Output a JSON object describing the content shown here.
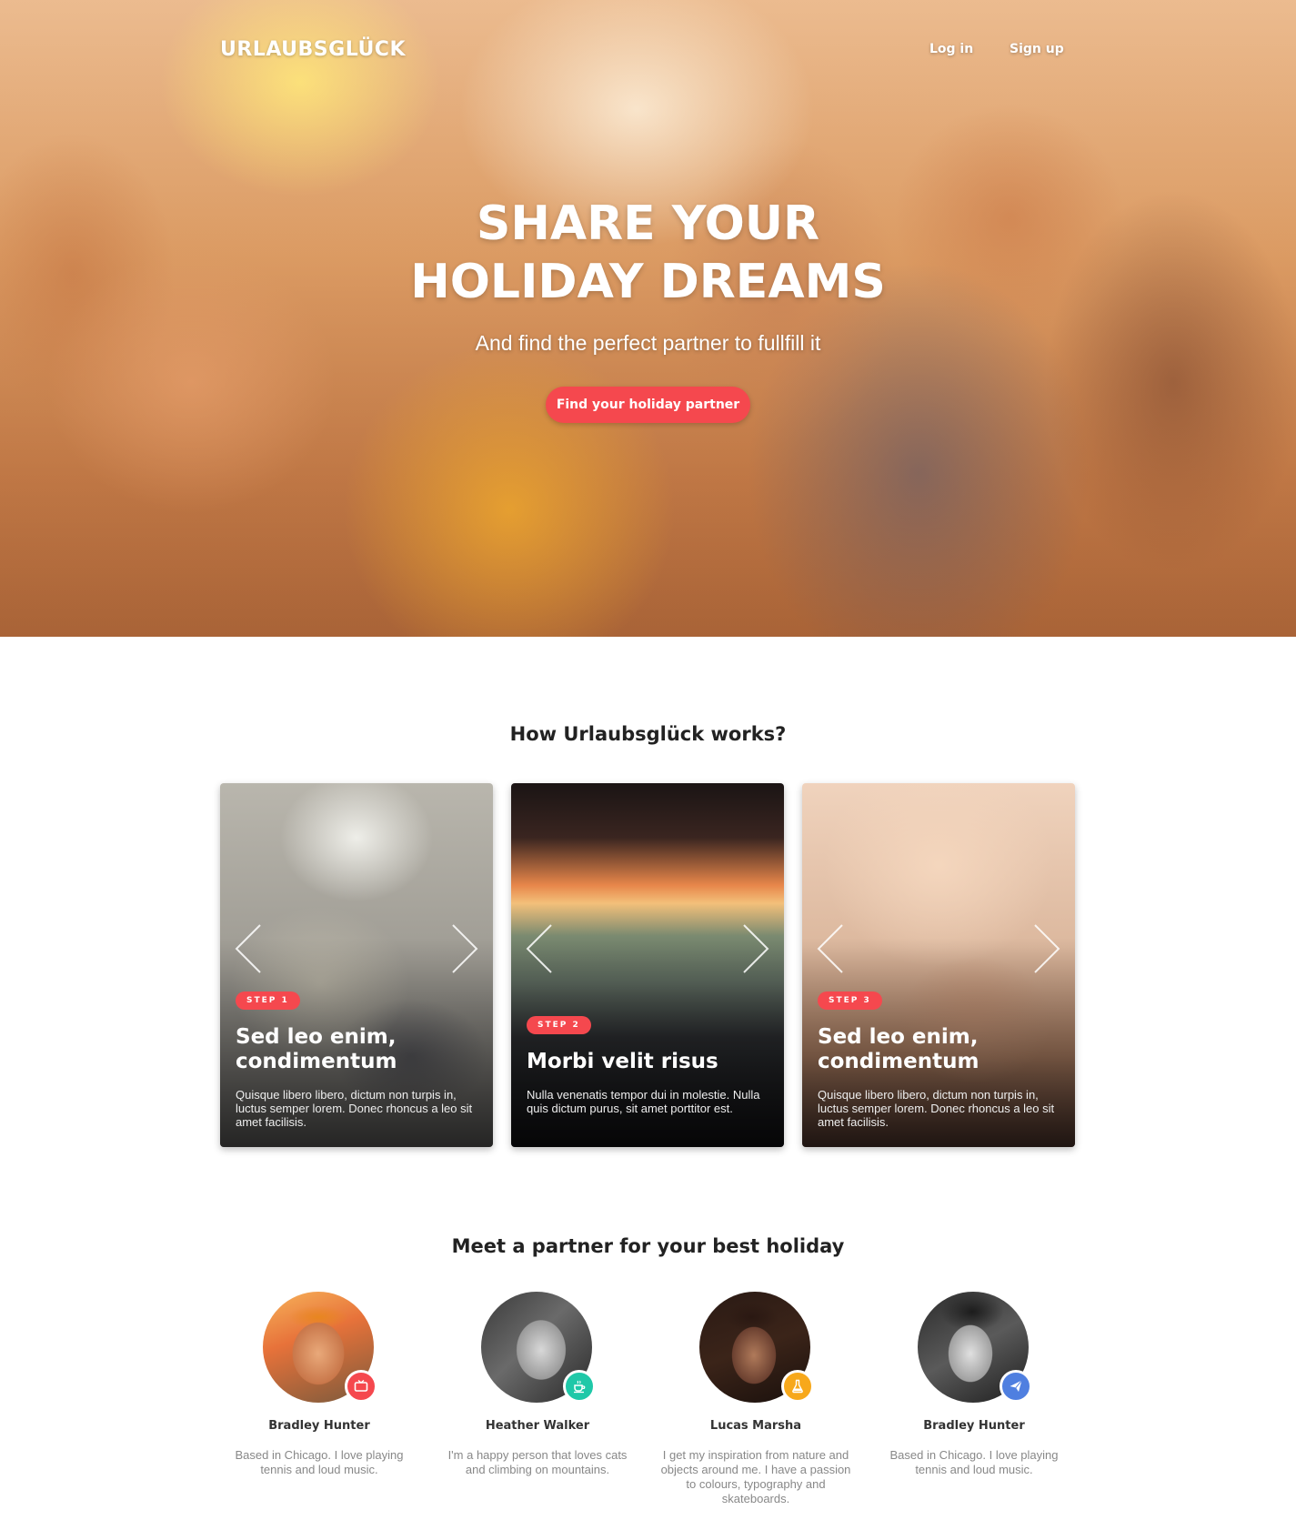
{
  "header": {
    "brand": "URLAUBSGLÜCK",
    "nav": {
      "login": "Log in",
      "signup": "Sign up"
    }
  },
  "hero": {
    "title_line1": "SHARE YOUR",
    "title_line2": "HOLIDAY DREAMS",
    "subtitle": "And find the perfect partner to fullfill it",
    "cta": "Find your holiday partner"
  },
  "how": {
    "title": "How Urlaubsglück works?",
    "cards": [
      {
        "step": "STEP 1",
        "title_line1": "Sed leo enim,",
        "title_line2": "condimentum",
        "text": "Quisque libero libero, dictum non turpis in, luctus semper lorem. Donec rhoncus a leo sit amet facilisis."
      },
      {
        "step": "STEP 2",
        "title_line1": "Morbi velit risus",
        "text": "Nulla venenatis tempor dui in molestie. Nulla quis dictum purus, sit amet porttitor est."
      },
      {
        "step": "STEP 3",
        "title_line1": "Sed leo enim,",
        "title_line2": "condimentum",
        "text": "Quisque libero libero, dictum non turpis in, luctus semper lorem. Donec rhoncus a leo sit amet facilisis."
      }
    ]
  },
  "partners": {
    "title": "Meet a partner for your best holiday",
    "items": [
      {
        "name": "Bradley Hunter",
        "desc": "Based in Chicago. I love playing tennis and loud music.",
        "badge_icon": "tv-icon",
        "badge_color": "#f5484e"
      },
      {
        "name": "Heather Walker",
        "desc": "I'm a happy person that loves cats and climbing on mountains.",
        "badge_icon": "coffee-icon",
        "badge_color": "#1fc8a8"
      },
      {
        "name": "Lucas Marsha",
        "desc": "I get my inspiration from nature and objects around me. I have a passion to colours, typography and skateboards.",
        "badge_icon": "flask-icon",
        "badge_color": "#f7a81b"
      },
      {
        "name": "Bradley Hunter",
        "desc": "Based in Chicago. I love playing tennis and loud music.",
        "badge_icon": "paper-plane-icon",
        "badge_color": "#4f7fe0"
      }
    ]
  },
  "colors": {
    "accent": "#f5484e"
  }
}
